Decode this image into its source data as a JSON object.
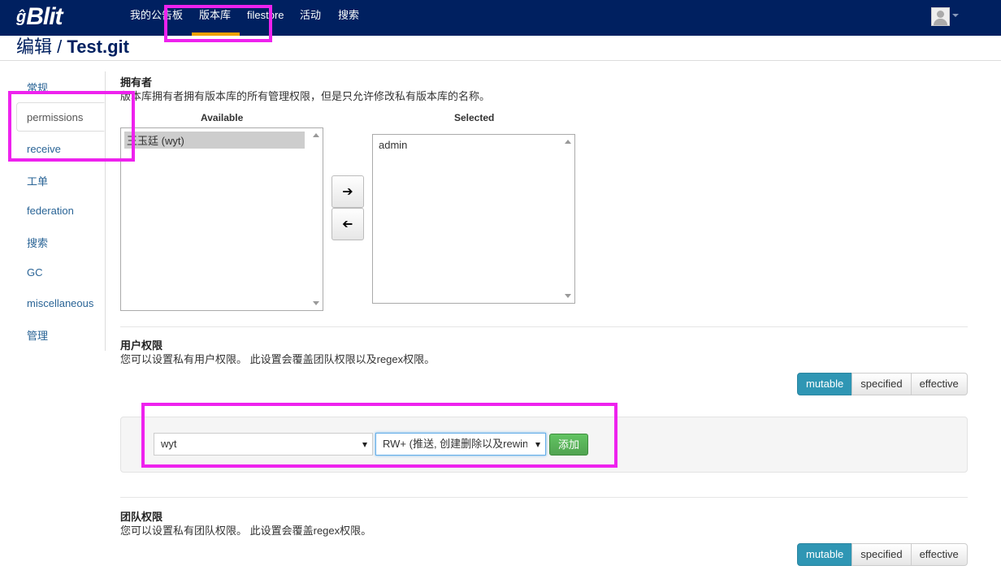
{
  "app": {
    "logo_text": "Blit",
    "logo_glyph": "ĝ"
  },
  "nav": {
    "items": [
      {
        "label": "我的公告板"
      },
      {
        "label": "版本库"
      },
      {
        "label": "filestore"
      },
      {
        "label": "活动"
      },
      {
        "label": "搜索"
      }
    ],
    "accent_color": "#f0a000",
    "bar_color": "#002060"
  },
  "page": {
    "title_prefix": "编辑",
    "separator": "/",
    "title_repo": "Test.git"
  },
  "sidebar": {
    "items": [
      {
        "label": "常规"
      },
      {
        "label": "permissions"
      },
      {
        "label": "receive"
      },
      {
        "label": "工单"
      },
      {
        "label": "federation"
      },
      {
        "label": "搜索"
      },
      {
        "label": "GC"
      },
      {
        "label": "miscellaneous"
      },
      {
        "label": "管理"
      }
    ],
    "active": "permissions"
  },
  "owners": {
    "title": "拥有者",
    "description": "版本库拥有者拥有版本库的所有管理权限，但是只允许修改私有版本库的名称。",
    "available_header": "Available",
    "selected_header": "Selected",
    "available_items": [
      "王玉廷 (wyt)"
    ],
    "selected_items": [
      "admin"
    ],
    "move_right_icon": "arrow-right-icon",
    "move_left_icon": "arrow-left-icon"
  },
  "user_permissions": {
    "title": "用户权限",
    "description": "您可以设置私有用户权限。 此设置会覆盖团队权限以及regex权限。",
    "toggle": {
      "mutable": "mutable",
      "specified": "specified",
      "effective": "effective",
      "active": "mutable"
    },
    "user_select": "wyt",
    "permission_select": "RW+ (推送, 创建删除以及rewind)",
    "add_label": "添加"
  },
  "team_permissions": {
    "title": "团队权限",
    "description": "您可以设置私有团队权限。 此设置会覆盖regex权限。",
    "toggle": {
      "mutable": "mutable",
      "specified": "specified",
      "effective": "effective",
      "active": "mutable"
    }
  },
  "highlight_color": "#ee22ee"
}
